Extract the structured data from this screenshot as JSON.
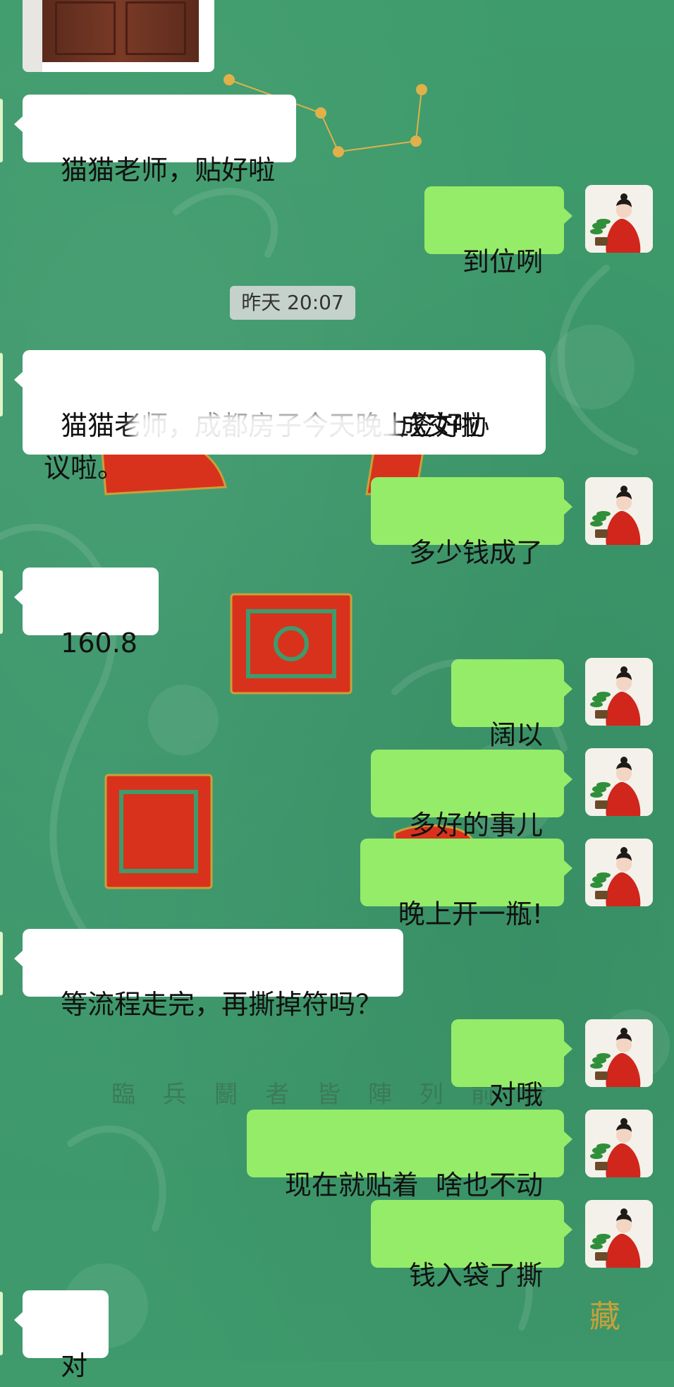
{
  "colors": {
    "background": "#3f9a6c",
    "incoming_bubble": "#ffffff",
    "outgoing_bubble": "#95ec69",
    "timestamp_bg": "#dcdcdc"
  },
  "timestamp": "昨天 20:07",
  "messages": [
    {
      "side": "left",
      "text": "猫猫老师，贴好啦"
    },
    {
      "side": "right",
      "text": "到位咧",
      "avatar": "avatar-woman-red-dress"
    },
    {
      "side": "left",
      "text": "猫猫老师，成都房子今天晚上签好协\n议啦。"
    },
    {
      "side": "left",
      "text": "成交啦"
    },
    {
      "side": "right",
      "text": "多少钱成了",
      "avatar": "avatar-woman-red-dress"
    },
    {
      "side": "left",
      "text": "160.8"
    },
    {
      "side": "right",
      "text": "阔以",
      "avatar": "avatar-woman-red-dress"
    },
    {
      "side": "right",
      "text": "多好的事儿",
      "avatar": "avatar-woman-red-dress"
    },
    {
      "side": "right",
      "text": "晚上开一瓶!",
      "avatar": "avatar-woman-red-dress"
    },
    {
      "side": "left",
      "text": "等流程走完，再撕掉符吗？"
    },
    {
      "side": "right",
      "text": "对哦",
      "avatar": "avatar-woman-red-dress"
    },
    {
      "side": "right",
      "text": "现在就贴着  啥也不动",
      "avatar": "avatar-woman-red-dress"
    },
    {
      "side": "right",
      "text": "钱入袋了撕",
      "avatar": "avatar-woman-red-dress"
    },
    {
      "side": "left",
      "text": "对"
    }
  ],
  "background_text": "臨兵鬭者皆陣列前行"
}
